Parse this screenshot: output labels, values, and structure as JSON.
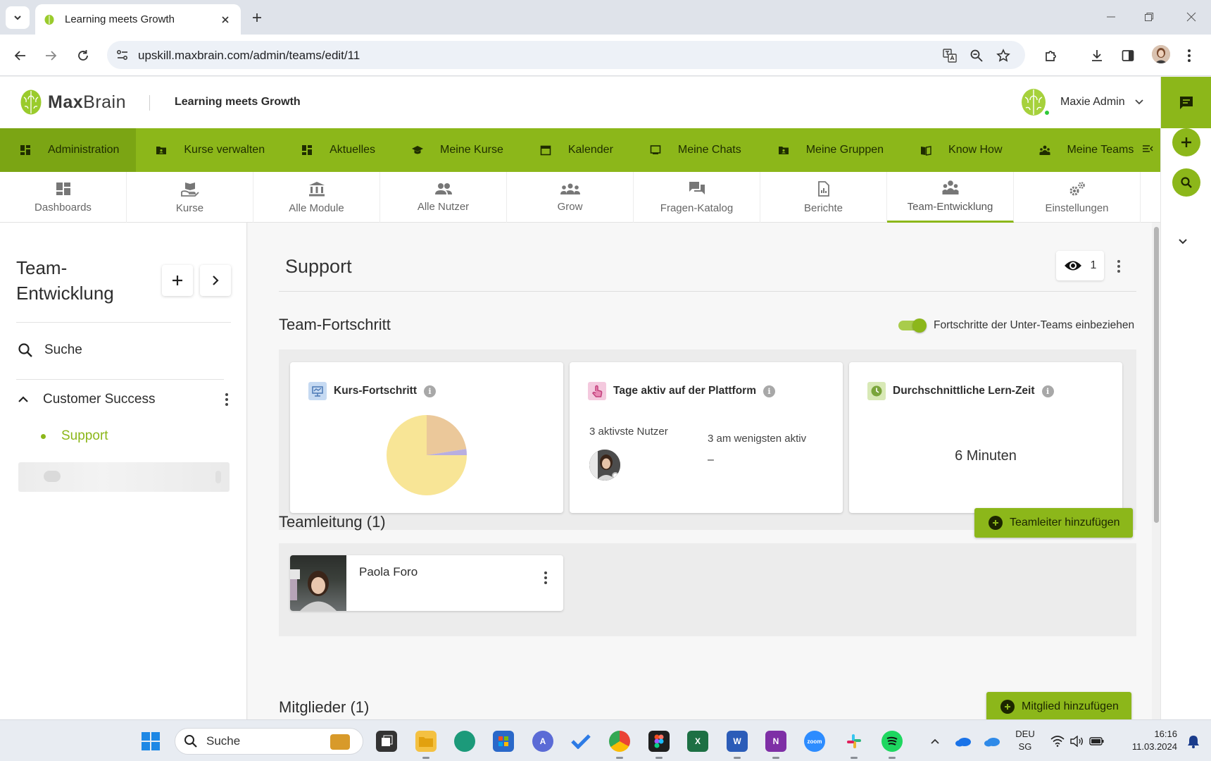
{
  "browser": {
    "tab_title": "Learning meets Growth",
    "url": "upskill.maxbrain.com/admin/teams/edit/11"
  },
  "header": {
    "brand_prefix": "Max",
    "brand_suffix": "Brain",
    "tagline": "Learning meets Growth",
    "user_name": "Maxie Admin"
  },
  "main_nav": {
    "items": [
      {
        "label": "Administration",
        "icon": "grid-icon",
        "active": true
      },
      {
        "label": "Kurse verwalten",
        "icon": "folder-user-icon"
      },
      {
        "label": "Aktuelles",
        "icon": "grid-icon"
      },
      {
        "label": "Meine Kurse",
        "icon": "graduation-cap-icon"
      },
      {
        "label": "Kalender",
        "icon": "calendar-icon"
      },
      {
        "label": "Meine Chats",
        "icon": "chat-box-icon"
      },
      {
        "label": "Meine Gruppen",
        "icon": "folder-user-icon"
      },
      {
        "label": "Know How",
        "icon": "book-icon"
      },
      {
        "label": "Meine Teams",
        "icon": "team-icon"
      }
    ]
  },
  "subtabs": [
    {
      "label": "Dashboards",
      "icon": "dashboard-icon"
    },
    {
      "label": "Kurse",
      "icon": "hand-book-icon"
    },
    {
      "label": "Alle Module",
      "icon": "institution-icon"
    },
    {
      "label": "Alle Nutzer",
      "icon": "users-icon"
    },
    {
      "label": "Grow",
      "icon": "group-icon"
    },
    {
      "label": "Fragen-Katalog",
      "icon": "forum-icon"
    },
    {
      "label": "Berichte",
      "icon": "report-icon"
    },
    {
      "label": "Team-Entwicklung",
      "icon": "team-icon",
      "active": true
    },
    {
      "label": "Einstellungen",
      "icon": "gears-icon"
    }
  ],
  "sidebar": {
    "title_line1": "Team-",
    "title_line2": "Entwicklung",
    "search_label": "Suche",
    "group_label": "Customer Success",
    "subitem_label": "Support"
  },
  "content": {
    "title": "Support",
    "viewer_count": "1",
    "progress_heading": "Team-Fortschritt",
    "toggle_label": "Fortschritte der Unter-Teams einbeziehen",
    "toggle_on": true,
    "cards": {
      "kurs": {
        "title": "Kurs-Fortschritt",
        "pie": [
          {
            "fraction": 0.225,
            "color": "#ebc89a"
          },
          {
            "fraction": 0.025,
            "color": "#b8aee0"
          },
          {
            "fraction": 0.75,
            "color": "#f8e596"
          }
        ]
      },
      "tage": {
        "title": "Tage aktiv auf der Plattform",
        "most_label": "3 aktivste Nutzer",
        "least_label": "3 am wenigsten aktiv",
        "least_value": "–"
      },
      "lern": {
        "title": "Durchschnittliche Lern-Zeit",
        "value": "6 Minuten"
      }
    },
    "leader_heading": "Teamleitung (1)",
    "add_leader_label": "Teamleiter hinzufügen",
    "leader_name": "Paola Foro",
    "members_heading": "Mitglieder (1)",
    "add_member_label": "Mitglied hinzufügen"
  },
  "taskbar": {
    "search_label": "Suche",
    "lang_line1": "DEU",
    "lang_line2": "SG",
    "time": "16:16",
    "date": "11.03.2024"
  },
  "colors": {
    "brand_green": "#8cb71a",
    "nav_active": "#7ba514"
  }
}
